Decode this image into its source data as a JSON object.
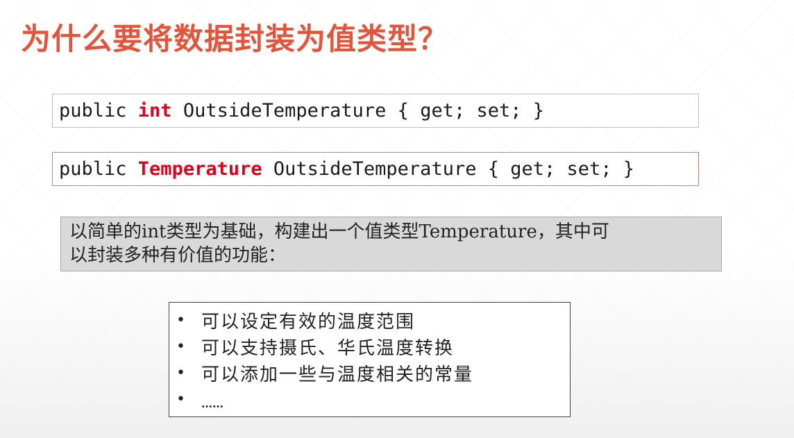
{
  "slide": {
    "title": "为什么要将数据封装为值类型？",
    "code_lines": [
      {
        "prefix": "public ",
        "keyword": "int",
        "suffix": " OutsideTemperature { get; set; }"
      },
      {
        "prefix": "public ",
        "keyword": "Temperature",
        "suffix": " OutsideTemperature { get; set; }"
      }
    ],
    "note": {
      "line1": "以简单的int类型为基础，构建出一个值类型Temperature，其中可",
      "line2": "以封装多种有价值的功能："
    },
    "bullet_symbol": "•",
    "bullets": [
      "可以设定有效的温度范围",
      "可以支持摄氏、华氏温度转换",
      "可以添加一些与温度相关的常量",
      "……"
    ],
    "colors": {
      "title": "#e2553a",
      "keyword": "#e3001b"
    }
  }
}
